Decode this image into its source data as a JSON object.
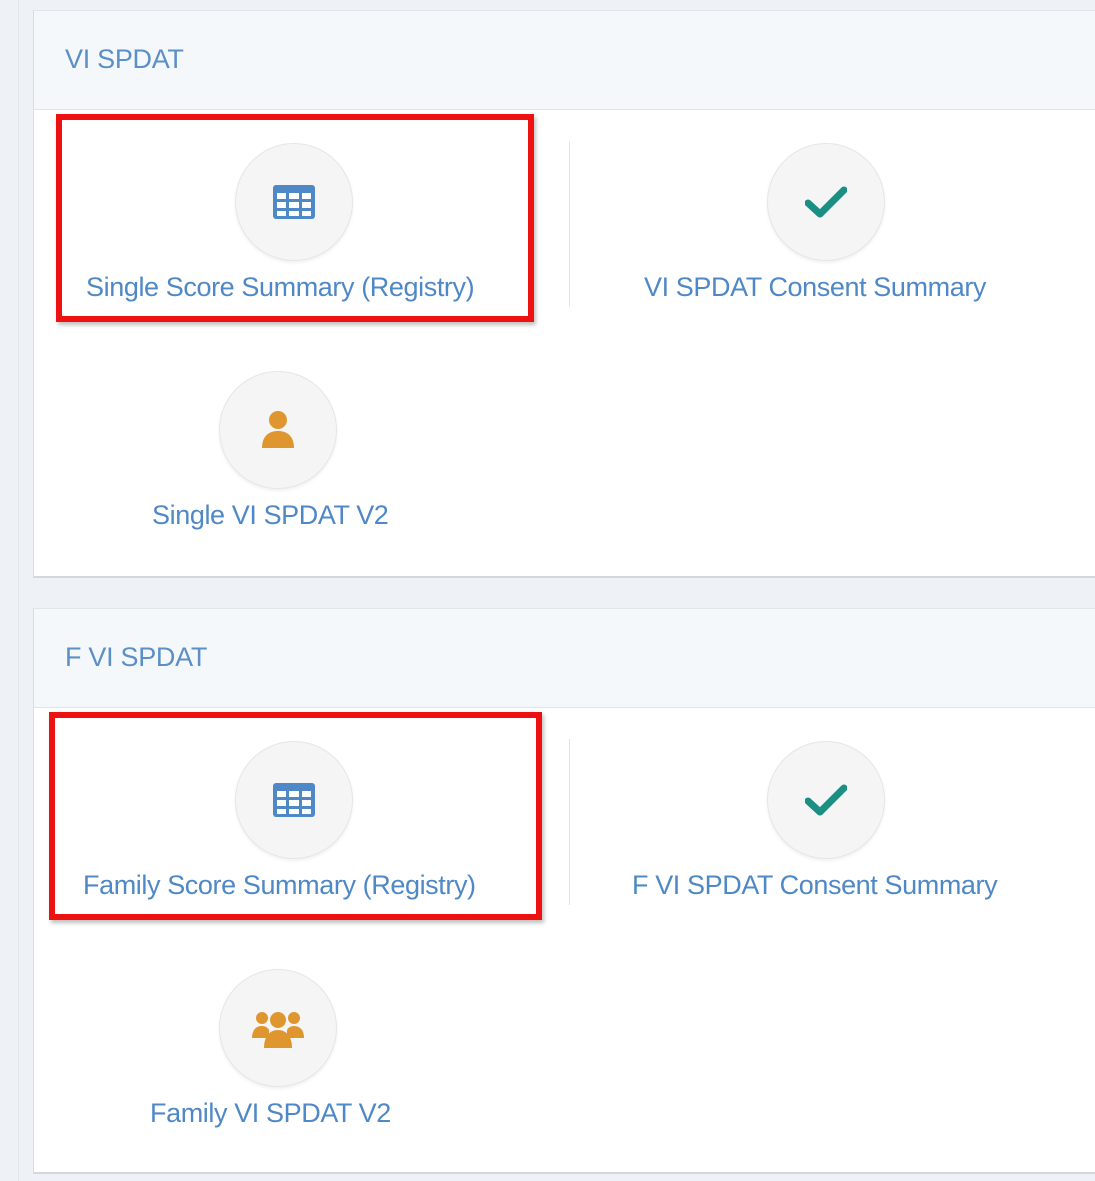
{
  "sections": [
    {
      "title": "VI SPDAT",
      "tiles": [
        {
          "label": "Single Score Summary (Registry)",
          "icon": "table-icon",
          "color": "#4f88c6"
        },
        {
          "label": "VI SPDAT Consent Summary",
          "icon": "check-icon",
          "color": "#1a8f84"
        },
        {
          "label": "Single VI SPDAT V2",
          "icon": "user-icon",
          "color": "#e0962e"
        }
      ]
    },
    {
      "title": "F VI SPDAT",
      "tiles": [
        {
          "label": "Family Score Summary (Registry)",
          "icon": "table-icon",
          "color": "#4f88c6"
        },
        {
          "label": "F VI SPDAT Consent Summary",
          "icon": "check-icon",
          "color": "#1a8f84"
        },
        {
          "label": "Family VI SPDAT V2",
          "icon": "users-icon",
          "color": "#e0962e"
        }
      ]
    }
  ],
  "colors": {
    "highlight": "#ee1111",
    "link": "#4f88c6",
    "header_text": "#5b8fc7"
  }
}
